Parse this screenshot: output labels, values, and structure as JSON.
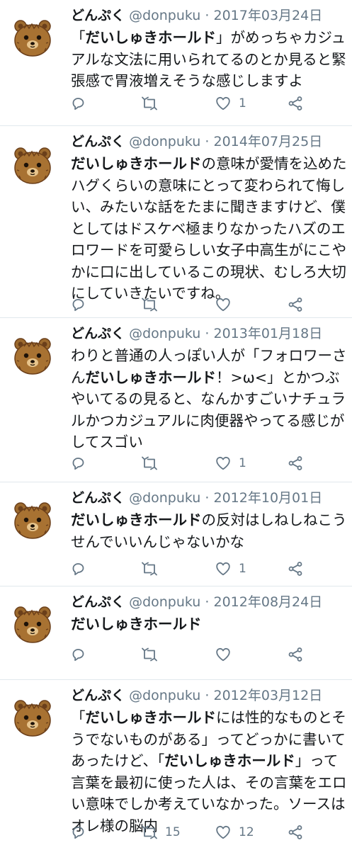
{
  "tweets": [
    {
      "name": "どんぷく",
      "handle": "@donpuku",
      "separator": "·",
      "date": "2017年03月24日",
      "body": [
        {
          "text": "「",
          "bold": false
        },
        {
          "text": "だいしゅきホールド",
          "bold": true
        },
        {
          "text": "」がめっちゃカジュアルな文法に用いられてるのとか見ると緊張感で胃液増えそうな感じしますよ",
          "bold": false
        }
      ],
      "retweets": "",
      "likes": "1"
    },
    {
      "name": "どんぷく",
      "handle": "@donpuku",
      "separator": "·",
      "date": "2014年07月25日",
      "body": [
        {
          "text": "だいしゅきホールド",
          "bold": true
        },
        {
          "text": "の意味が愛情を込めたハグくらいの意味にとって変わられて悔しい、みたいな話をたまに聞きますけど、僕としてはドスケベ極まりなかったハズのエロワードを可愛らしい女子中高生がにこやかに口に出しているこの現状、むしろ大切にしていきたいですね。",
          "bold": false
        }
      ],
      "retweets": "",
      "likes": ""
    },
    {
      "name": "どんぷく",
      "handle": "@donpuku",
      "separator": "·",
      "date": "2013年01月18日",
      "body": [
        {
          "text": "わりと普通の人っぽい人が「フォロワーさん",
          "bold": false
        },
        {
          "text": "だいしゅきホールド",
          "bold": true
        },
        {
          "text": "！>ω<」とかつぶやいてるの見ると、なんかすごいナチュラルかつカジュアルに肉便器やってる感じがしてスゴい",
          "bold": false
        }
      ],
      "retweets": "",
      "likes": "1"
    },
    {
      "name": "どんぷく",
      "handle": "@donpuku",
      "separator": "·",
      "date": "2012年10月01日",
      "body": [
        {
          "text": "だいしゅきホールド",
          "bold": true
        },
        {
          "text": "の反対はしねしねこうせんでいいんじゃないかな",
          "bold": false
        }
      ],
      "retweets": "",
      "likes": "1"
    },
    {
      "name": "どんぷく",
      "handle": "@donpuku",
      "separator": "·",
      "date": "2012年08月24日",
      "body": [
        {
          "text": "だいしゅきホールド",
          "bold": true
        }
      ],
      "retweets": "",
      "likes": ""
    },
    {
      "name": "どんぷく",
      "handle": "@donpuku",
      "separator": "·",
      "date": "2012年03月12日",
      "body": [
        {
          "text": "「",
          "bold": false
        },
        {
          "text": "だいしゅきホールド",
          "bold": true
        },
        {
          "text": "には性的なものとそうでないものがある」ってどっかに書いてあったけど、「",
          "bold": false
        },
        {
          "text": "だいしゅきホールド",
          "bold": true
        },
        {
          "text": "」って言葉を最初に使った人は、その言葉をエロい意味でしか考えていなかった。ソースはオレ様の脳内",
          "bold": false
        }
      ],
      "retweets": "15",
      "likes": "12"
    }
  ],
  "icons": {
    "avatar": "bear-face-icon",
    "reply": "reply-bubble-icon",
    "retweet": "retweet-icon",
    "like": "heart-outline-icon",
    "share": "share-icon"
  },
  "colors": {
    "text": "#14171a",
    "muted": "#657786",
    "divider": "#e1e8ed",
    "bear": "#9c6a2e",
    "bear_dark": "#6b3f1a"
  }
}
